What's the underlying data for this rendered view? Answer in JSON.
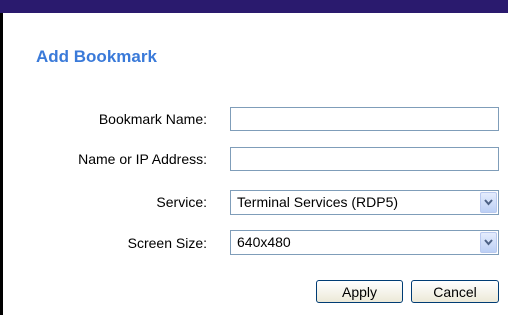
{
  "form": {
    "title": "Add Bookmark",
    "bookmark_name": {
      "label": "Bookmark Name:",
      "value": ""
    },
    "address": {
      "label": "Name or IP Address:",
      "value": ""
    },
    "service": {
      "label": "Service:",
      "selected": "Terminal Services (RDP5)"
    },
    "screen_size": {
      "label": "Screen Size:",
      "selected": "640x480"
    },
    "apply_label": "Apply",
    "cancel_label": "Cancel"
  },
  "colors": {
    "title": "#3a7ad9",
    "topbar": "#2a1a6e",
    "field_border": "#7f9db9"
  }
}
